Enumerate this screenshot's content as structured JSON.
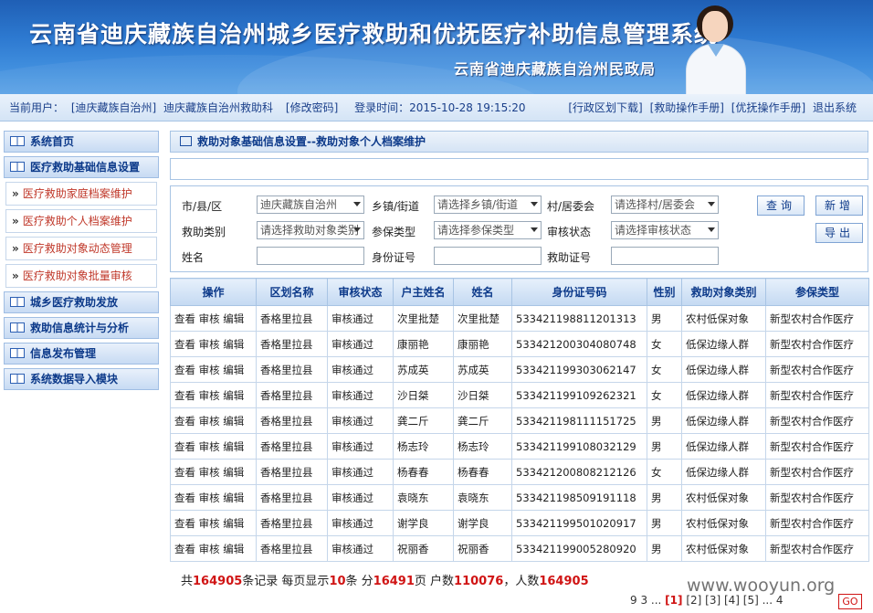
{
  "header": {
    "title": "云南省迪庆藏族自治州城乡医疗救助和优抚医疗补助信息管理系统",
    "org": "云南省迪庆藏族自治州民政局"
  },
  "infobar": {
    "user_label": "当前用户：",
    "user_region": "[迪庆藏族自治州]",
    "user_dept": "迪庆藏族自治州救助科",
    "change_password": "[修改密码]",
    "login_time": "登录时间：2015-10-28 19:15:20",
    "download_region": "[行政区划下载]",
    "relief_manual": "[救助操作手册]",
    "care_manual": "[优抚操作手册]",
    "logout": "退出系统"
  },
  "sidebar": {
    "items": [
      {
        "type": "head",
        "label": "系统首页"
      },
      {
        "type": "head",
        "label": "医疗救助基础信息设置"
      },
      {
        "type": "sub",
        "label": "医疗救助家庭档案维护"
      },
      {
        "type": "sub",
        "label": "医疗救助个人档案维护"
      },
      {
        "type": "sub",
        "label": "医疗救助对象动态管理"
      },
      {
        "type": "sub",
        "label": "医疗救助对象批量审核"
      },
      {
        "type": "head",
        "label": "城乡医疗救助发放"
      },
      {
        "type": "head",
        "label": "救助信息统计与分析"
      },
      {
        "type": "head",
        "label": "信息发布管理"
      },
      {
        "type": "head",
        "label": "系统数据导入模块"
      }
    ]
  },
  "breadcrumb": "救助对象基础信息设置--救助对象个人档案维护",
  "filters": {
    "county_label": "市/县/区",
    "county_value": "迪庆藏族自治州",
    "town_label": "乡镇/街道",
    "town_value": "请选择乡镇/街道",
    "village_label": "村/居委会",
    "village_value": "请选择村/居委会",
    "type_label": "救助类别",
    "type_value": "请选择救助对象类别",
    "insurance_label": "参保类型",
    "insurance_value": "请选择参保类型",
    "status_label": "审核状态",
    "status_value": "请选择审核状态",
    "name_label": "姓名",
    "id_label": "身份证号",
    "cert_label": "救助证号",
    "query_btn": "查询",
    "add_btn": "新增",
    "export_btn": "导出"
  },
  "table": {
    "columns": [
      "操作",
      "区划名称",
      "审核状态",
      "户主姓名",
      "姓名",
      "身份证号码",
      "性别",
      "救助对象类别",
      "参保类型"
    ],
    "rows": [
      [
        "查看 审核 编辑",
        "香格里拉县",
        "审核通过",
        "次里批楚",
        "次里批楚",
        "533421198811201313",
        "男",
        "农村低保对象",
        "新型农村合作医疗"
      ],
      [
        "查看 审核 编辑",
        "香格里拉县",
        "审核通过",
        "康丽艳",
        "康丽艳",
        "533421200304080748",
        "女",
        "低保边缘人群",
        "新型农村合作医疗"
      ],
      [
        "查看 审核 编辑",
        "香格里拉县",
        "审核通过",
        "苏成英",
        "苏成英",
        "533421199303062147",
        "女",
        "低保边缘人群",
        "新型农村合作医疗"
      ],
      [
        "查看 审核 编辑",
        "香格里拉县",
        "审核通过",
        "沙日桀",
        "沙日桀",
        "533421199109262321",
        "女",
        "低保边缘人群",
        "新型农村合作医疗"
      ],
      [
        "查看 审核 编辑",
        "香格里拉县",
        "审核通过",
        "龚二斤",
        "龚二斤",
        "533421198111151725",
        "男",
        "低保边缘人群",
        "新型农村合作医疗"
      ],
      [
        "查看 审核 编辑",
        "香格里拉县",
        "审核通过",
        "杨志玲",
        "杨志玲",
        "533421199108032129",
        "男",
        "低保边缘人群",
        "新型农村合作医疗"
      ],
      [
        "查看 审核 编辑",
        "香格里拉县",
        "审核通过",
        "杨春春",
        "杨春春",
        "533421200808212126",
        "女",
        "低保边缘人群",
        "新型农村合作医疗"
      ],
      [
        "查看 审核 编辑",
        "香格里拉县",
        "审核通过",
        "袁晓东",
        "袁晓东",
        "533421198509191118",
        "男",
        "农村低保对象",
        "新型农村合作医疗"
      ],
      [
        "查看 审核 编辑",
        "香格里拉县",
        "审核通过",
        "谢学良",
        "谢学良",
        "533421199501020917",
        "男",
        "农村低保对象",
        "新型农村合作医疗"
      ],
      [
        "查看 审核 编辑",
        "香格里拉县",
        "审核通过",
        "祝丽香",
        "祝丽香",
        "533421199005280920",
        "男",
        "农村低保对象",
        "新型农村合作医疗"
      ]
    ]
  },
  "summary": {
    "p1": "共",
    "total_records": "164905",
    "p2": "条记录 每页显示",
    "per_page": "10",
    "p3": "条 分",
    "pages": "16491",
    "p4": "页 户数",
    "households": "110076",
    "p5": "，人数",
    "people": "164905"
  },
  "pager": {
    "prefix": "9 3 ...",
    "current": "[1]",
    "rest": "[2] [3] [4] [5] ... 4",
    "go": "GO"
  },
  "watermark": "www.wooyun.org"
}
